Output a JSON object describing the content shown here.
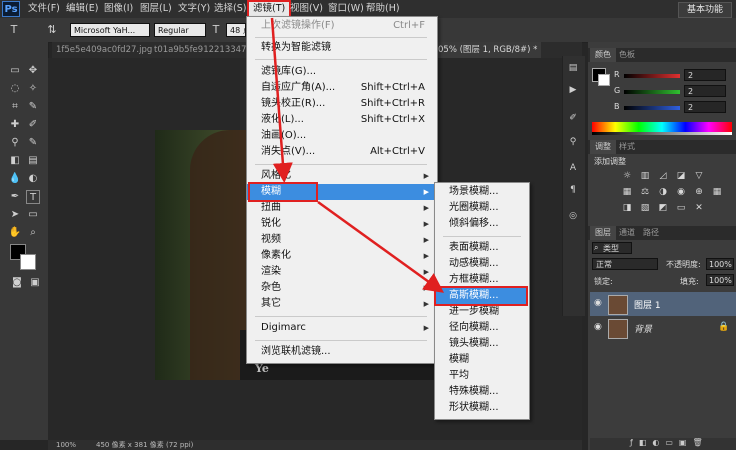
{
  "app": {
    "logo": "Ps",
    "workspace": "基本功能"
  },
  "menubar": [
    "文件(F)",
    "编辑(E)",
    "图像(I)",
    "图层(L)",
    "文字(Y)",
    "选择(S)",
    "滤镜(T)",
    "视图(V)",
    "窗口(W)",
    "帮助(H)"
  ],
  "options": {
    "font": "Microsoft YaH...",
    "style": "Regular",
    "size": "48 点"
  },
  "tabs": [
    "1f5e5e409ac0fd27.jpg",
    "t01a9b5fe912213347e.jpg",
    "05% (图层 1, RGB/8#) *"
  ],
  "status": {
    "zoom": "100%",
    "info": "450 像素 x 381 像素 (72 ppi)"
  },
  "photo_text": "Ye",
  "filter_menu": {
    "items": [
      {
        "label": "上次滤镜操作(F)",
        "shortcut": "Ctrl+F",
        "disabled": true
      },
      {
        "label": "转换为智能滤镜",
        "shortcut": ""
      },
      {
        "label": "滤镜库(G)...",
        "shortcut": ""
      },
      {
        "label": "自适应广角(A)...",
        "shortcut": "Shift+Ctrl+A"
      },
      {
        "label": "镜头校正(R)...",
        "shortcut": "Shift+Ctrl+R"
      },
      {
        "label": "液化(L)...",
        "shortcut": "Shift+Ctrl+X"
      },
      {
        "label": "油画(O)...",
        "shortcut": ""
      },
      {
        "label": "消失点(V)...",
        "shortcut": "Alt+Ctrl+V"
      },
      {
        "label": "风格化",
        "submenu": true
      },
      {
        "label": "模糊",
        "submenu": true,
        "highlighted": true
      },
      {
        "label": "扭曲",
        "submenu": true
      },
      {
        "label": "锐化",
        "submenu": true
      },
      {
        "label": "视频",
        "submenu": true
      },
      {
        "label": "像素化",
        "submenu": true
      },
      {
        "label": "渲染",
        "submenu": true
      },
      {
        "label": "杂色",
        "submenu": true
      },
      {
        "label": "其它",
        "submenu": true
      },
      {
        "label": "Digimarc",
        "submenu": true
      },
      {
        "label": "浏览联机滤镜...",
        "shortcut": ""
      }
    ]
  },
  "blur_submenu": {
    "items": [
      "场景模糊...",
      "光圈模糊...",
      "倾斜偏移...",
      "表面模糊...",
      "动感模糊...",
      "方框模糊...",
      "高斯模糊...",
      "进一步模糊",
      "径向模糊...",
      "镜头模糊...",
      "模糊",
      "平均",
      "特殊模糊...",
      "形状模糊..."
    ],
    "highlighted": "高斯模糊..."
  },
  "color_panel": {
    "tabs": [
      "颜色",
      "色板"
    ],
    "channels": [
      {
        "label": "R",
        "value": "2",
        "color": "#e03030"
      },
      {
        "label": "G",
        "value": "2",
        "color": "#30c030"
      },
      {
        "label": "B",
        "value": "2",
        "color": "#3060e0"
      }
    ]
  },
  "adjust_panel": {
    "tabs": [
      "调整",
      "样式"
    ],
    "title": "添加调整"
  },
  "layers_panel": {
    "tabs": [
      "图层",
      "通道",
      "路径"
    ],
    "filter": "类型",
    "blend": "正常",
    "opacity_label": "不透明度:",
    "opacity": "100%",
    "lock_label": "锁定:",
    "fill_label": "填充:",
    "fill": "100%",
    "layers": [
      {
        "name": "图层 1",
        "selected": true
      },
      {
        "name": "背景",
        "locked": true
      }
    ]
  }
}
